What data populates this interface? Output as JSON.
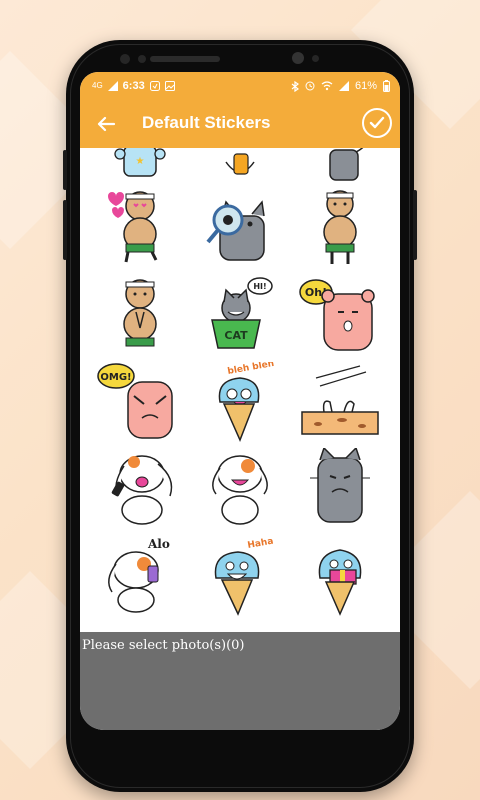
{
  "status_bar": {
    "network": "4G",
    "time": "6:33",
    "battery": "61%"
  },
  "app_bar": {
    "title": "Default Stickers"
  },
  "stickers": {
    "bubbles": [
      "HI!",
      "Oh!",
      "OMG!",
      "bleh bleh",
      "Alo",
      "Haha"
    ],
    "cat_label": "CAT"
  },
  "bottom": {
    "selection_text": "Please select photo(s)(0)"
  },
  "colors": {
    "accent": "#f4ac3a",
    "panel": "#6e6e6e"
  }
}
